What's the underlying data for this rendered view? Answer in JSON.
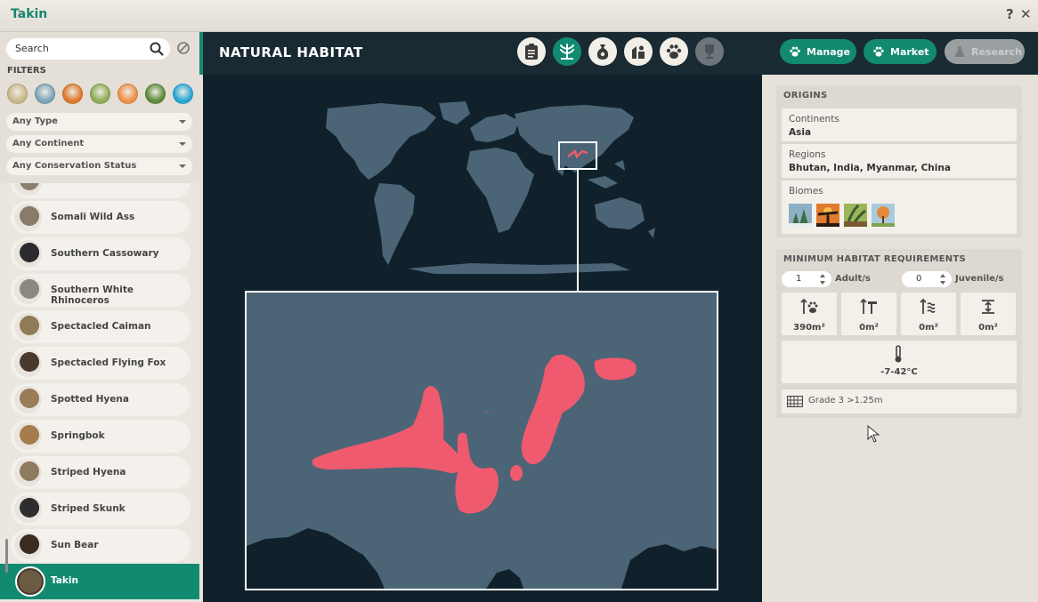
{
  "window": {
    "title": "Takin",
    "help": "?",
    "close": "✕"
  },
  "search": {
    "placeholder": "Search"
  },
  "filters": {
    "label": "FILTERS",
    "biomes": [
      {
        "name": "grassland",
        "color": "#c9b98a"
      },
      {
        "name": "tundra",
        "color": "#7ea6b8"
      },
      {
        "name": "desert",
        "color": "#e07a2e"
      },
      {
        "name": "temperate",
        "color": "#8fae57"
      },
      {
        "name": "aquatic-sunset",
        "color": "#f0904a"
      },
      {
        "name": "tropical",
        "color": "#5f8b3c"
      },
      {
        "name": "ocean",
        "color": "#2aa7d8"
      }
    ],
    "type": "Any Type",
    "continent": "Any Continent",
    "status": "Any Conservation Status"
  },
  "animals": [
    {
      "name": "",
      "avatar": "#8a7f70"
    },
    {
      "name": "Somali Wild Ass",
      "avatar": "#8a7a68"
    },
    {
      "name": "Southern Cassowary",
      "avatar": "#2b2b2f"
    },
    {
      "name": "Southern White Rhinoceros",
      "avatar": "#8c877f"
    },
    {
      "name": "Spectacled Caiman",
      "avatar": "#8f7b55"
    },
    {
      "name": "Spectacled Flying Fox",
      "avatar": "#4a3a2e"
    },
    {
      "name": "Spotted Hyena",
      "avatar": "#9a7d58"
    },
    {
      "name": "Springbok",
      "avatar": "#a67c4e"
    },
    {
      "name": "Striped Hyena",
      "avatar": "#8e7a5f"
    },
    {
      "name": "Striped Skunk",
      "avatar": "#2e2e2e"
    },
    {
      "name": "Sun Bear",
      "avatar": "#3b2c20"
    },
    {
      "name": "Takin",
      "avatar": "#6b5a44",
      "selected": true
    }
  ],
  "header": {
    "title": "NATURAL HABITAT",
    "tabs": [
      "clipboard",
      "habitat",
      "food",
      "enrichment",
      "paw",
      "trophy"
    ],
    "manage": "Manage",
    "market": "Market",
    "research": "Research"
  },
  "origins": {
    "title": "ORIGINS",
    "continents_label": "Continents",
    "continents": "Asia",
    "regions_label": "Regions",
    "regions": "Bhutan, India, Myanmar, China",
    "biomes_label": "Biomes"
  },
  "requirements": {
    "title": "MINIMUM HABITAT REQUIREMENTS",
    "adults": "1",
    "adults_label": "Adult/s",
    "juveniles": "0",
    "juveniles_label": "Juvenile/s",
    "land": "390m²",
    "climbing": "0m²",
    "water": "0m²",
    "deep_water": "0m²",
    "temperature": "-7-42°C",
    "barrier": "Grade 3  >1.25m"
  },
  "colors": {
    "accent": "#128a70",
    "habitat": "#f05a6e",
    "land": "#4b6577",
    "ocean": "#11212b"
  }
}
